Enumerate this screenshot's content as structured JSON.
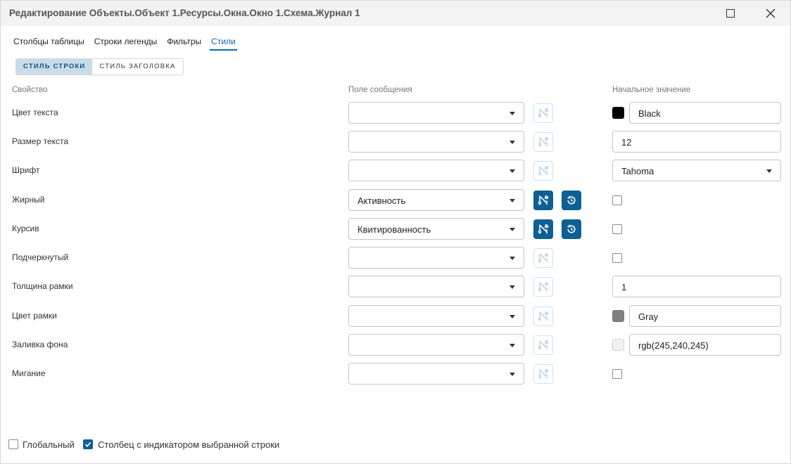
{
  "window": {
    "title": "Редактирование Объекты.Объект 1.Ресурсы.Окна.Окно 1.Схема.Журнал 1"
  },
  "tabs": [
    {
      "label": "Столбцы таблицы"
    },
    {
      "label": "Строки легенды"
    },
    {
      "label": "Фильтры"
    },
    {
      "label": "Стили",
      "active": true
    }
  ],
  "style_toggle": {
    "row_style": "СТИЛЬ СТРОКИ",
    "header_style": "СТИЛЬ ЗАГОЛОВКА"
  },
  "columns": {
    "property": "Свойство",
    "message_field": "Поле сообщения",
    "initial_value": "Начальное значение"
  },
  "rows": [
    {
      "label": "Цвет текста",
      "field": "",
      "value": "Black",
      "swatch": "#000000"
    },
    {
      "label": "Размер текста",
      "field": "",
      "value": "12"
    },
    {
      "label": "Шрифт",
      "field": "",
      "value": "Tahoma"
    },
    {
      "label": "Жирный",
      "field": "Активность",
      "checked": false
    },
    {
      "label": "Курсив",
      "field": "Квитированность",
      "checked": false
    },
    {
      "label": "Подчеркнутый",
      "field": "",
      "checked": false
    },
    {
      "label": "Толщина рамки",
      "field": "",
      "value": "1"
    },
    {
      "label": "Цвет рамки",
      "field": "",
      "value": "Gray",
      "swatch": "#808080"
    },
    {
      "label": "Заливка фона",
      "field": "",
      "value": "rgb(245,240,245)",
      "swatch": "#f5f0f5"
    },
    {
      "label": "Мигание",
      "field": "",
      "checked": false
    }
  ],
  "footer": {
    "global_label": "Глобальный",
    "global_checked": false,
    "indicator_label": "Столбец с индикатором выбранной строки",
    "indicator_checked": true
  },
  "colors": {
    "accent": "#0e5f95",
    "tab_active": "#0a66b0",
    "toggle_active_bg": "#c9dcea"
  }
}
